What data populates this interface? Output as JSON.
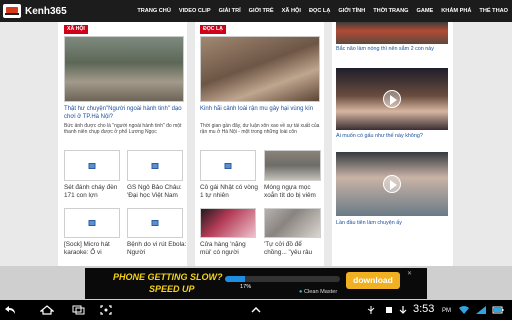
{
  "app": {
    "title": "Kenh365"
  },
  "nav": [
    "TRANG CHỦ",
    "VIDEO CLIP",
    "GIẢI TRÍ",
    "GIỚI TRẺ",
    "XÃ HỘI",
    "ĐỌC LẠ",
    "GIỚI TÍNH",
    "THỜI TRANG",
    "GAME",
    "KHÁM PHÁ",
    "THỂ THAO"
  ],
  "articles": [
    {
      "tag": "XÃ HỘI",
      "headline": "Thật hư chuyện\"Người ngoài hành tinh\" dạo chơi ở TP.Hà Nội?",
      "summary": "Bức ảnh được cho là \"người ngoài hành tinh\" đo một thanh niên chụp được ở phố Lương Ngọc"
    },
    {
      "tag": "ĐỌC LẠ",
      "headline": "Kinh hãi cảnh loài rận mu gây hại vùng kín",
      "summary": "Thời gian gần đây, dư luận xôn xao về sự tái xuất của rận mu ở Hà Nội - một trong những loài côn"
    }
  ],
  "cards": [
    {
      "title": "Sét đánh cháy đèn 171 con lợn"
    },
    {
      "title": "GS Ngô Bảo Châu: 'Đại học Việt Nam"
    },
    {
      "title": "[Sock] Micro hát karaoke: Ổ vi"
    },
    {
      "title": "Bệnh do vi rút Ebola: Người"
    },
    {
      "title": "Cô gái Nhật có vòng 1 tự nhiên"
    },
    {
      "title": "Móng ngựa mọc xoắn tít do bị viêm"
    },
    {
      "title": "Cửa hàng 'nặng mùi' có người"
    },
    {
      "title": "'Tự cởi đồ để chồng... \"yêu râu"
    }
  ],
  "right_column": [
    {
      "caption": "Bắc não làm nóng thì nên sắm 2 con này"
    },
    {
      "caption": "Ai muốn có gấu như thế này không?"
    },
    {
      "caption": "Lần đầu tiên làm chuyện ấy"
    }
  ],
  "ad": {
    "line1": "PHONE GETTING SLOW?",
    "line2": "SPEED UP",
    "progress_percent": 17,
    "progress_label": "17%",
    "brand": "Clean Master",
    "button": "download",
    "close": "✕"
  },
  "system": {
    "time": "3:53",
    "ampm": "PM"
  },
  "icons": [
    "back-icon",
    "home-icon",
    "recent-apps-icon",
    "screenshot-icon",
    "menu-up-icon",
    "usb-icon",
    "wifi-icon",
    "battery-icon",
    "signal-icon"
  ],
  "colors": {
    "topbar": "#1c1c1c",
    "tag": "#d0021b",
    "link": "#1a4f9c",
    "ad_yellow": "#f5d21a",
    "ad_button": "#f0b021"
  }
}
